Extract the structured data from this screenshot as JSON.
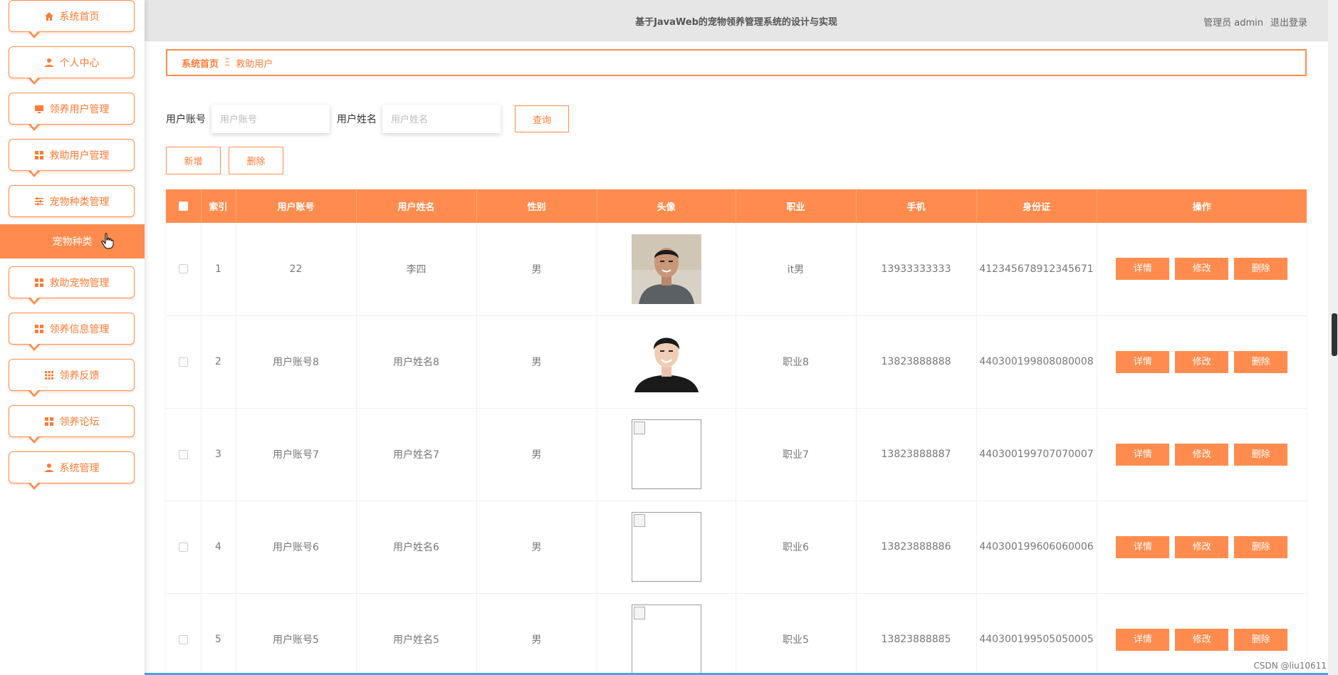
{
  "header": {
    "title": "基于JavaWeb的宠物领养管理系统的设计与实现",
    "role_user": "管理员 admin",
    "logout": "退出登录"
  },
  "sidebar": {
    "items": [
      {
        "label": "系统首页",
        "icon": "home-icon"
      },
      {
        "label": "个人中心",
        "icon": "user-icon"
      },
      {
        "label": "领养用户管理",
        "icon": "monitor-icon"
      },
      {
        "label": "救助用户管理",
        "icon": "grid-icon"
      },
      {
        "label": "宠物种类管理",
        "icon": "sliders-icon"
      },
      {
        "label": "救助宠物管理",
        "icon": "grid-icon"
      },
      {
        "label": "领养信息管理",
        "icon": "grid-icon"
      },
      {
        "label": "领养反馈",
        "icon": "apps-icon"
      },
      {
        "label": "领养论坛",
        "icon": "grid-icon"
      },
      {
        "label": "系统管理",
        "icon": "user-icon"
      }
    ],
    "active_sub": "宠物种类"
  },
  "breadcrumb": {
    "home": "系统首页",
    "separator": "Ξ",
    "current": "救助用户"
  },
  "search": {
    "account_label": "用户账号",
    "account_placeholder": "用户账号",
    "name_label": "用户姓名",
    "name_placeholder": "用户姓名",
    "query_button": "查询"
  },
  "actions": {
    "add": "新增",
    "delete": "删除"
  },
  "table": {
    "columns": [
      "索引",
      "用户账号",
      "用户姓名",
      "性别",
      "头像",
      "职业",
      "手机",
      "身份证",
      "操作"
    ],
    "op_labels": {
      "detail": "详情",
      "edit": "修改",
      "delete": "删除"
    },
    "rows": [
      {
        "index": "1",
        "account": "22",
        "name": "李四",
        "gender": "男",
        "avatar": "photo-man-1",
        "job": "it男",
        "phone": "13933333333",
        "idcard": "412345678912345671"
      },
      {
        "index": "2",
        "account": "用户账号8",
        "name": "用户姓名8",
        "gender": "男",
        "avatar": "photo-man-2",
        "job": "职业8",
        "phone": "13823888888",
        "idcard": "440300199808080008"
      },
      {
        "index": "3",
        "account": "用户账号7",
        "name": "用户姓名7",
        "gender": "男",
        "avatar": "broken-image",
        "job": "职业7",
        "phone": "13823888887",
        "idcard": "440300199707070007"
      },
      {
        "index": "4",
        "account": "用户账号6",
        "name": "用户姓名6",
        "gender": "男",
        "avatar": "broken-image",
        "job": "职业6",
        "phone": "13823888886",
        "idcard": "440300199606060006"
      },
      {
        "index": "5",
        "account": "用户账号5",
        "name": "用户姓名5",
        "gender": "男",
        "avatar": "broken-image",
        "job": "职业5",
        "phone": "13823888885",
        "idcard": "440300199505050005"
      }
    ]
  },
  "watermark": "CSDN @liu10611",
  "colors": {
    "accent": "#ff8c4e",
    "header_bg": "#e6e6e6"
  }
}
